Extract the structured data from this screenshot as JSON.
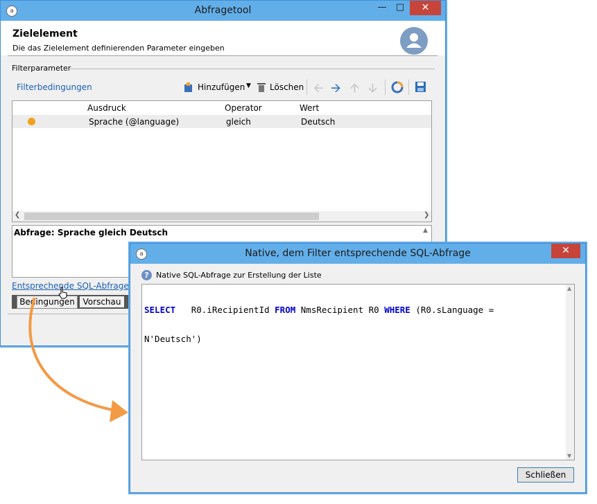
{
  "main_window": {
    "title": "Abfragetool",
    "header_title": "Zielelement",
    "header_subtitle": "Die das Zielelement definierenden Parameter eingeben",
    "group_label": "Filterparameter",
    "filter_link": "Filterbedingungen",
    "toolbar": {
      "add_label": "Hinzufügen",
      "delete_label": "Löschen"
    },
    "table": {
      "columns": [
        "Ausdruck",
        "Operator",
        "Wert"
      ],
      "rows": [
        {
          "expression": "Sprache (@language)",
          "operator": "gleich",
          "value": "Deutsch"
        }
      ]
    },
    "query_text": "Abfrage: Sprache gleich Deutsch",
    "sql_link": "Entsprechende SQL-Abfrage...",
    "tabs": [
      "Bedingungen",
      "Vorschau"
    ]
  },
  "sql_dialog": {
    "title": "Native, dem Filter entsprechende SQL-Abfrage",
    "info_text": "Native SQL-Abfrage zur Erstellung der Liste",
    "sql_line1": [
      {
        "t": "SELECT",
        "kw": true
      },
      {
        "t": "   R0.iRecipientId ",
        "kw": false
      },
      {
        "t": "FROM",
        "kw": true
      },
      {
        "t": " NmsRecipient R0 ",
        "kw": false
      },
      {
        "t": "WHERE",
        "kw": true
      },
      {
        "t": " (R0.sLanguage =",
        "kw": false
      }
    ],
    "sql_line2": "N'Deutsch')",
    "close_button": "Schließen"
  },
  "colors": {
    "titlebar": "#62aee9",
    "close": "#c7443a",
    "keyword": "#0000c8",
    "arrow": "#f39a44",
    "link": "#1a5fb4"
  }
}
